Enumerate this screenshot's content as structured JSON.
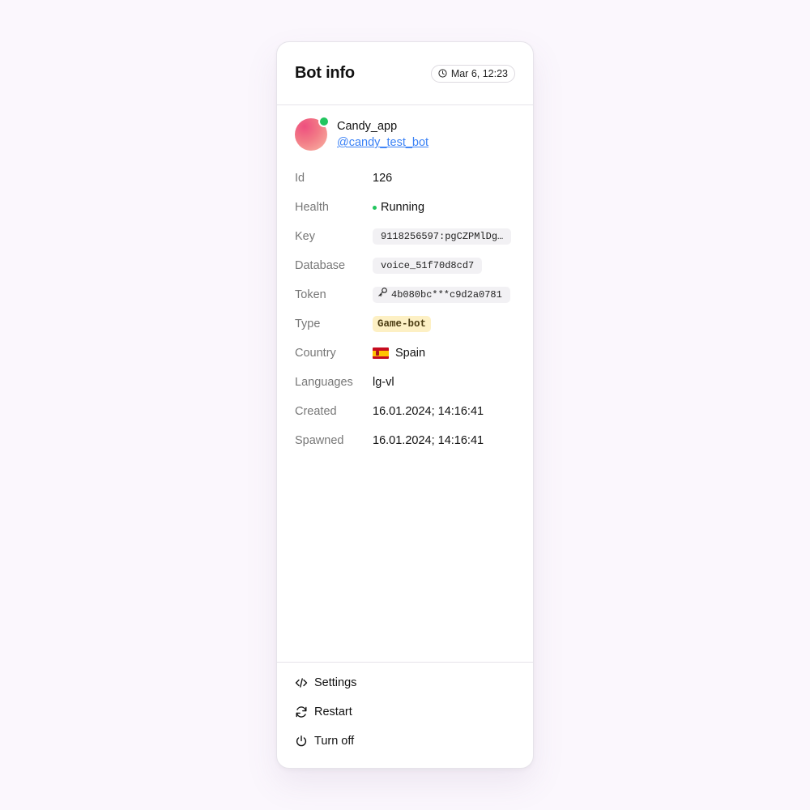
{
  "header": {
    "title": "Bot info",
    "timestamp": "Mar 6, 12:23"
  },
  "profile": {
    "name": "Candy_app",
    "handle": "@candy_test_bot",
    "status_color": "#22c55e"
  },
  "fields": {
    "id": {
      "label": "Id",
      "value": "126"
    },
    "health": {
      "label": "Health",
      "value": "Running",
      "status_color": "#22c55e"
    },
    "key": {
      "label": "Key",
      "value": "9118256597:pgCZPMlDg…"
    },
    "database": {
      "label": "Database",
      "value": "voice_51f70d8cd7"
    },
    "token": {
      "label": "Token",
      "value": "4b080bc***c9d2a0781",
      "icon": "key-icon"
    },
    "type": {
      "label": "Type",
      "value": "Game-bot"
    },
    "country": {
      "label": "Country",
      "value": "Spain",
      "flag": "spain-flag-icon"
    },
    "languages": {
      "label": "Languages",
      "value": "lg-vl"
    },
    "created": {
      "label": "Created",
      "value": "16.01.2024; 14:16:41"
    },
    "spawned": {
      "label": "Spawned",
      "value": "16.01.2024; 14:16:41"
    }
  },
  "actions": {
    "settings": {
      "label": "Settings",
      "icon": "code-icon"
    },
    "restart": {
      "label": "Restart",
      "icon": "refresh-icon"
    },
    "turn_off": {
      "label": "Turn off",
      "icon": "power-icon"
    }
  }
}
